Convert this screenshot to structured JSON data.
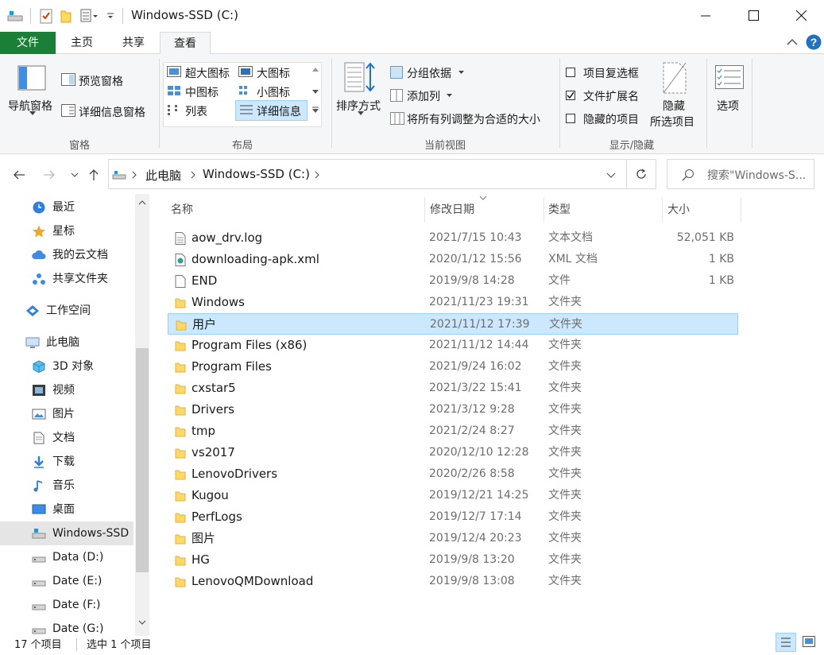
{
  "window": {
    "title": "Windows-SSD (C:)"
  },
  "ribbon_tabs": [
    {
      "label": "文件"
    },
    {
      "label": "主页"
    },
    {
      "label": "共享"
    },
    {
      "label": "查看"
    }
  ],
  "ribbon": {
    "panes": {
      "nav_pane": "导航窗格",
      "preview_pane": "预览窗格",
      "details_pane": "详细信息窗格",
      "group": "窗格"
    },
    "layout": {
      "extra_large": "超大图标",
      "large": "大图标",
      "medium": "中图标",
      "small": "小图标",
      "list": "列表",
      "details": "详细信息",
      "group": "布局"
    },
    "current_view": {
      "sort_by": "排序方式",
      "group_by": "分组依据",
      "add_column": "添加列",
      "fit_columns": "将所有列调整为合适的大小",
      "group": "当前视图"
    },
    "show_hide": {
      "item_checkboxes": "项目复选框",
      "item_checkboxes_checked": false,
      "file_extensions": "文件扩展名",
      "file_extensions_checked": true,
      "hidden_items": "隐藏的项目",
      "hidden_items_checked": false,
      "hide_selected_1": "隐藏",
      "hide_selected_2": "所选项目",
      "group": "显示/隐藏"
    },
    "options": "选项"
  },
  "address": {
    "crumbs": [
      "此电脑",
      "Windows-SSD (C:)"
    ],
    "search_placeholder": "搜索\"Windows-S..."
  },
  "nav": {
    "items": [
      {
        "label": "最近",
        "icon": "clock-icon"
      },
      {
        "label": "星标",
        "icon": "star-icon"
      },
      {
        "label": "我的云文档",
        "icon": "cloud-icon"
      },
      {
        "label": "共享文件夹",
        "icon": "share-icon"
      },
      {
        "label": "工作空间",
        "icon": "workspace-icon"
      },
      {
        "label": "此电脑",
        "icon": "computer-icon"
      },
      {
        "label": "3D 对象",
        "icon": "cube-icon"
      },
      {
        "label": "视频",
        "icon": "video-icon"
      },
      {
        "label": "图片",
        "icon": "picture-icon"
      },
      {
        "label": "文档",
        "icon": "document-icon"
      },
      {
        "label": "下载",
        "icon": "download-icon"
      },
      {
        "label": "音乐",
        "icon": "music-icon"
      },
      {
        "label": "桌面",
        "icon": "desktop-icon"
      },
      {
        "label": "Windows-SSD",
        "icon": "drive-windows-icon"
      },
      {
        "label": "Data (D:)",
        "icon": "drive-icon"
      },
      {
        "label": "Date (E:)",
        "icon": "drive-icon"
      },
      {
        "label": "Date (F:)",
        "icon": "drive-icon"
      },
      {
        "label": "Date (G:)",
        "icon": "drive-icon"
      }
    ]
  },
  "columns": {
    "name": "名称",
    "date": "修改日期",
    "type": "类型",
    "size": "大小"
  },
  "files": [
    {
      "name": "aow_drv.log",
      "date": "2021/7/15 10:43",
      "type": "文本文档",
      "size": "52,051 KB",
      "icon": "text-file-icon"
    },
    {
      "name": "downloading-apk.xml",
      "date": "2020/1/12 15:56",
      "type": "XML 文档",
      "size": "1 KB",
      "icon": "xml-file-icon"
    },
    {
      "name": "END",
      "date": "2019/9/8 14:28",
      "type": "文件",
      "size": "1 KB",
      "icon": "file-icon"
    },
    {
      "name": "Windows",
      "date": "2021/11/23 19:31",
      "type": "文件夹",
      "size": "",
      "icon": "folder-icon"
    },
    {
      "name": "用户",
      "date": "2021/11/12 17:39",
      "type": "文件夹",
      "size": "",
      "icon": "folder-icon"
    },
    {
      "name": "Program Files (x86)",
      "date": "2021/11/12 14:44",
      "type": "文件夹",
      "size": "",
      "icon": "folder-icon"
    },
    {
      "name": "Program Files",
      "date": "2021/9/24 16:02",
      "type": "文件夹",
      "size": "",
      "icon": "folder-icon"
    },
    {
      "name": "cxstar5",
      "date": "2021/3/22 15:41",
      "type": "文件夹",
      "size": "",
      "icon": "folder-icon"
    },
    {
      "name": "Drivers",
      "date": "2021/3/12 9:28",
      "type": "文件夹",
      "size": "",
      "icon": "folder-icon"
    },
    {
      "name": "tmp",
      "date": "2021/2/24 8:27",
      "type": "文件夹",
      "size": "",
      "icon": "folder-icon"
    },
    {
      "name": "vs2017",
      "date": "2020/12/10 12:28",
      "type": "文件夹",
      "size": "",
      "icon": "folder-icon"
    },
    {
      "name": "LenovoDrivers",
      "date": "2020/2/26 8:58",
      "type": "文件夹",
      "size": "",
      "icon": "folder-icon"
    },
    {
      "name": "Kugou",
      "date": "2019/12/21 14:25",
      "type": "文件夹",
      "size": "",
      "icon": "folder-icon"
    },
    {
      "name": "PerfLogs",
      "date": "2019/12/7 17:14",
      "type": "文件夹",
      "size": "",
      "icon": "folder-icon"
    },
    {
      "name": "图片",
      "date": "2019/12/4 20:23",
      "type": "文件夹",
      "size": "",
      "icon": "folder-icon"
    },
    {
      "name": "HG",
      "date": "2019/9/8 13:20",
      "type": "文件夹",
      "size": "",
      "icon": "folder-icon"
    },
    {
      "name": "LenovoQMDownload",
      "date": "2019/9/8 13:08",
      "type": "文件夹",
      "size": "",
      "icon": "folder-icon"
    }
  ],
  "selected_file": "用户",
  "status": {
    "count": "17 个项目",
    "selection": "选中 1 个项目"
  },
  "colors": {
    "file_tab": "#1a7f37",
    "selection_bg": "#cce8ff",
    "selection_border": "#99d1ff",
    "folder": "#ffd866",
    "accent": "#0078d7"
  }
}
